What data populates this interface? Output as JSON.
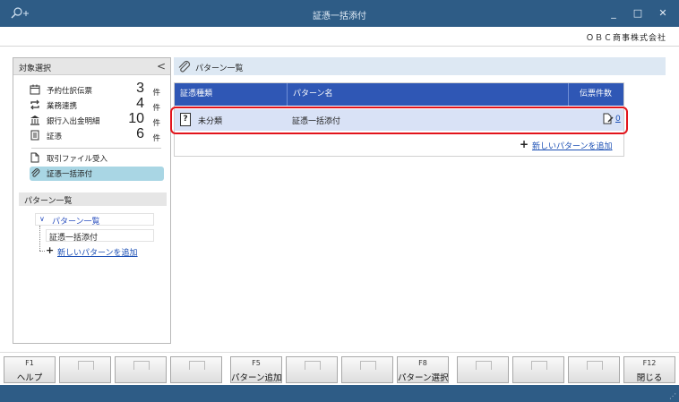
{
  "window": {
    "title": "証憑一括添付"
  },
  "company": "ＯＢＣ商事株式会社",
  "left_panel": {
    "header": "対象選択",
    "items": [
      {
        "label": "予約仕訳伝票",
        "count": "3",
        "unit": "件",
        "icon": "calendar-icon"
      },
      {
        "label": "業務連携",
        "count": "4",
        "unit": "件",
        "icon": "sync-icon"
      },
      {
        "label": "銀行入出金明細",
        "count": "10",
        "unit": "件",
        "icon": "bank-icon"
      },
      {
        "label": "証憑",
        "count": "6",
        "unit": "件",
        "icon": "document-icon"
      }
    ],
    "file_import": "取引ファイル受入",
    "bulk_attach": "証憑一括添付",
    "pattern_section": "パターン一覧",
    "tree": {
      "root": "パターン一覧",
      "child": "証憑一括添付",
      "add_link": "新しいパターンを追加"
    }
  },
  "main": {
    "title": "パターン一覧",
    "columns": [
      "証憑種類",
      "パターン名",
      "伝票件数"
    ],
    "rows": [
      {
        "type": "未分類",
        "pattern": "証憑一括添付",
        "count": "0"
      }
    ],
    "add_link": "新しいパターンを追加"
  },
  "fkeys": [
    {
      "key": "F1",
      "label": "ヘルプ"
    },
    {
      "key": "",
      "label": ""
    },
    {
      "key": "",
      "label": ""
    },
    {
      "key": "",
      "label": ""
    },
    {
      "key": "F5",
      "label": "パターン追加"
    },
    {
      "key": "",
      "label": ""
    },
    {
      "key": "",
      "label": ""
    },
    {
      "key": "F8",
      "label": "パターン選択"
    },
    {
      "key": "",
      "label": ""
    },
    {
      "key": "",
      "label": ""
    },
    {
      "key": "",
      "label": ""
    },
    {
      "key": "F12",
      "label": "閉じる"
    }
  ],
  "colors": {
    "titlebar": "#2e5c86",
    "grid_header": "#2f57b5",
    "selected_row": "#d9e2f6",
    "highlight": "#e2141c",
    "selected_nav": "#a9d6e4"
  }
}
